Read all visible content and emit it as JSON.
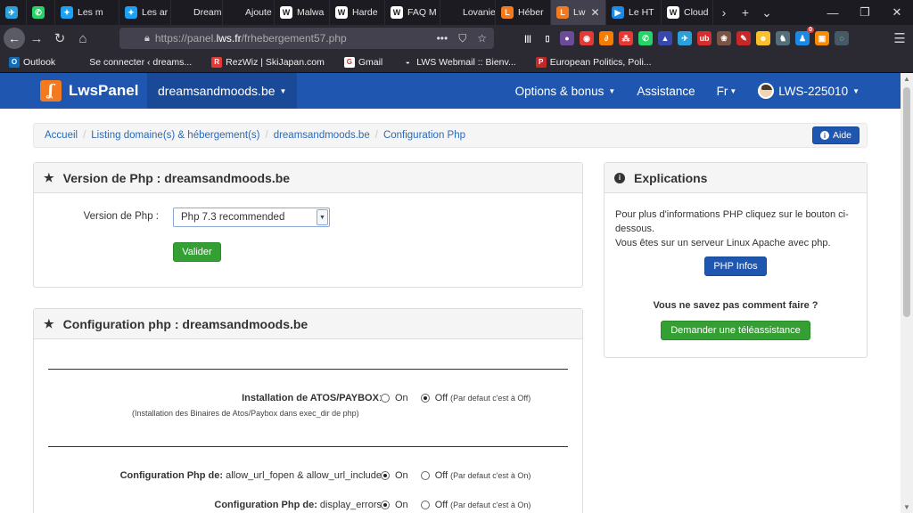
{
  "browser": {
    "tabs": [
      {
        "label": "",
        "color": "#2aa1da",
        "glyph": "✈"
      },
      {
        "label": "",
        "color": "#25d366",
        "glyph": "✆"
      },
      {
        "label": "Les m",
        "color": "#1da1f2",
        "glyph": "✦"
      },
      {
        "label": "Les ar",
        "color": "#1da1f2",
        "glyph": "✦"
      },
      {
        "label": "Dream",
        "color": "#1c1b22",
        "glyph": ""
      },
      {
        "label": "Ajoute",
        "color": "#1c1b22",
        "glyph": ""
      },
      {
        "label": "Malwa",
        "color": "#ffffff",
        "glyph": "W"
      },
      {
        "label": "Harde",
        "color": "#ffffff",
        "glyph": "W"
      },
      {
        "label": "FAQ M",
        "color": "#ffffff",
        "glyph": "W"
      },
      {
        "label": "Lovaniens",
        "color": "#1c1b22",
        "glyph": ""
      },
      {
        "label": "Héber",
        "color": "#f47a20",
        "glyph": "L"
      },
      {
        "label": "Lw",
        "color": "#f47a20",
        "glyph": "L",
        "active": true
      },
      {
        "label": "Le HT",
        "color": "#1e88e5",
        "glyph": "▶"
      },
      {
        "label": "Cloud",
        "color": "#ffffff",
        "glyph": "W"
      }
    ],
    "tab_controls": {
      "scroll": "›",
      "new_tab": "+",
      "list": "⌄"
    },
    "window_controls": {
      "minimize": "—",
      "restore": "❐",
      "close": "✕"
    },
    "address": {
      "prefix": "https://panel.",
      "host": "lws.fr",
      "path": "/frhebergement57.php"
    },
    "address_icons": {
      "more": "•••",
      "pocket": "⛉",
      "bookmark": "☆"
    },
    "extensions": [
      {
        "name": "library-icon",
        "color": "#2b2a33",
        "glyph": "|||"
      },
      {
        "name": "sidebar-icon",
        "color": "#2b2a33",
        "glyph": "▯"
      },
      {
        "name": "extension-1-icon",
        "color": "#6c4b9a",
        "glyph": "●"
      },
      {
        "name": "extension-2-icon",
        "color": "#e53935",
        "glyph": "◉"
      },
      {
        "name": "extension-3-icon",
        "color": "#f57c00",
        "glyph": "∂"
      },
      {
        "name": "extension-4-icon",
        "color": "#e53935",
        "glyph": "⁂"
      },
      {
        "name": "whatsapp-ext-icon",
        "color": "#25d366",
        "glyph": "✆"
      },
      {
        "name": "extension-5-icon",
        "color": "#3949ab",
        "glyph": "▲"
      },
      {
        "name": "telegram-ext-icon",
        "color": "#2aa1da",
        "glyph": "✈"
      },
      {
        "name": "extension-6-icon",
        "color": "#d32f2f",
        "glyph": "ub"
      },
      {
        "name": "extension-7-icon",
        "color": "#795548",
        "glyph": "❀"
      },
      {
        "name": "extension-8-icon",
        "color": "#c62828",
        "glyph": "✎"
      },
      {
        "name": "extension-9-icon",
        "color": "#fbc02d",
        "glyph": "☻"
      },
      {
        "name": "extension-10-icon",
        "color": "#546e7a",
        "glyph": "♞"
      },
      {
        "name": "extension-11-icon",
        "color": "#1e88e5",
        "glyph": "♟"
      },
      {
        "name": "extension-12-icon",
        "color": "#fb8c00",
        "glyph": "▣"
      },
      {
        "name": "extension-13-icon",
        "color": "#455a64",
        "glyph": "◌"
      }
    ],
    "extension_badge": "0",
    "menu_glyph": "☰",
    "bookmarks": [
      {
        "label": "Outlook",
        "color": "#0f6cbd",
        "glyph": "O"
      },
      {
        "label": "Se connecter ‹ dreams...",
        "color": "#2b2a33",
        "glyph": ""
      },
      {
        "label": "RezWiz | SkiJapan.com",
        "color": "#e53935",
        "glyph": "R"
      },
      {
        "label": "Gmail",
        "color": "#ffffff",
        "glyph": "G"
      },
      {
        "label": "LWS Webmail :: Bienv...",
        "color": "#2b2a33",
        "glyph": "◒"
      },
      {
        "label": "European Politics, Poli...",
        "color": "#c62828",
        "glyph": "P"
      }
    ]
  },
  "app": {
    "brand": "LwsPanel",
    "logo_glyph": "ʆ",
    "domain_dropdown": "dreamsandmoods.be",
    "nav": {
      "options": "Options & bonus",
      "assistance": "Assistance",
      "lang": "Fr",
      "account": "LWS-225010"
    },
    "breadcrumb": [
      "Accueil",
      "Listing domaine(s) & hébergement(s)",
      "dreamsandmoods.be",
      "Configuration Php"
    ],
    "help_button": "Aide",
    "version_panel": {
      "title": "Version de Php : dreamsandmoods.be",
      "field_label": "Version de Php :",
      "selected": "Php 7.3 recommended",
      "submit": "Valider"
    },
    "explanations_panel": {
      "title": "Explications",
      "text1": "Pour plus d'informations PHP cliquez sur le bouton ci-dessous.",
      "text2": "Vous êtes sur un serveur Linux Apache avec php.",
      "php_info_button": "PHP Infos",
      "question": "Vous ne savez pas comment faire ?",
      "assist_button": "Demander une téléassistance"
    },
    "config_panel": {
      "title": "Configuration php : dreamsandmoods.be",
      "rows": [
        {
          "label_bold": "Installation de ATOS/PAYBOX",
          "label_rest": ":",
          "sub": "(Installation des Binaires de Atos/Paybox dans exec_dir de php)",
          "on": "On",
          "off": "Off",
          "note": "(Par defaut c'est à Off)",
          "checked": "off"
        },
        {
          "label_bold": "Configuration Php de:",
          "label_rest": " allow_url_fopen & allow_url_include",
          "sub": "",
          "on": "On",
          "off": "Off",
          "note": "(Par defaut c'est à On)",
          "checked": "on"
        },
        {
          "label_bold": "Configuration Php de:",
          "label_rest": " display_errors",
          "sub": "",
          "on": "On",
          "off": "Off",
          "note": "(Par defaut c'est à On)",
          "checked": "on"
        }
      ]
    }
  },
  "colors": {
    "brand_blue": "#1f57b0",
    "brand_orange": "#f47a20",
    "success_green": "#34a033"
  }
}
